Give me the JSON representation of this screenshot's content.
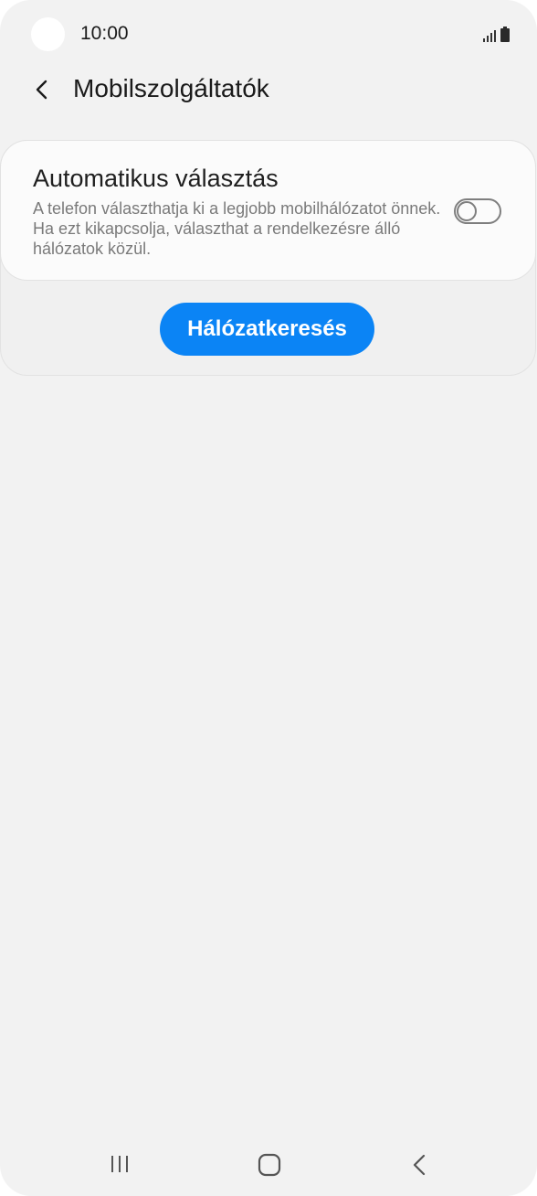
{
  "status_bar": {
    "time": "10:00",
    "icons": [
      "signal-icon",
      "battery-icon"
    ]
  },
  "header": {
    "back_icon": "chevron-left-icon",
    "title": "Mobilszolgáltatók"
  },
  "automatic_selection": {
    "title": "Automatikus választás",
    "description": "A telefon választhatja ki a legjobb mobilhálózatot önnek. Ha ezt kikapcsolja, választhat a rendelkezésre álló hálózatok közül.",
    "enabled": false
  },
  "network_search": {
    "label": "Hálózatkeresés"
  },
  "nav_bar": {
    "icons": [
      "recent-apps-icon",
      "home-icon",
      "back-icon"
    ]
  },
  "colors": {
    "accent": "#0b84f5",
    "background": "#f2f2f2"
  }
}
